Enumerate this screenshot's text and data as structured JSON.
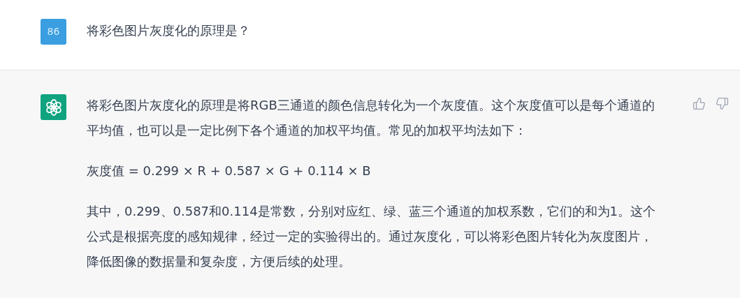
{
  "question": {
    "avatar": "86",
    "text": "将彩色图片灰度化的原理是？"
  },
  "answer": {
    "paragraphs": [
      {
        "kind": "text",
        "text": "将彩色图片灰度化的原理是将RGB三通道的颜色信息转化为一个灰度值。这个灰度值可以是每个通道的平均值，也可以是一定比例下各个通道的加权平均值。常见的加权平均法如下："
      },
      {
        "kind": "text",
        "text": "灰度值 = 0.299 × R + 0.587 × G + 0.114 × B"
      },
      {
        "kind": "text",
        "text": "其中，0.299、0.587和0.114是常数，分别对应红、绿、蓝三个通道的加权系数，它们的和为1。这个公式是根据亮度的感知规律，经过一定的实验得出的。通过灰度化，可以将彩色图片转化为灰度图片，降低图像的数据量和复杂度，方便后续的处理。"
      }
    ]
  }
}
